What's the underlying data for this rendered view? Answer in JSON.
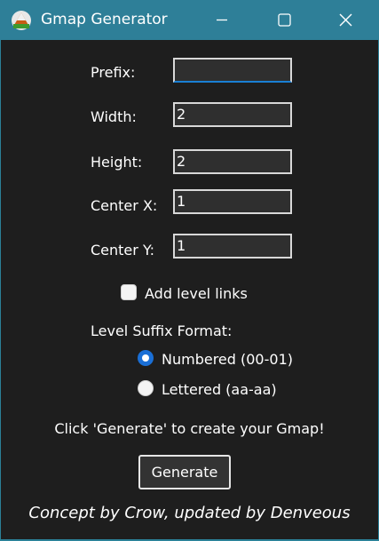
{
  "window": {
    "title": "Gmap Generator",
    "controls": {
      "minimize": "minimize-icon",
      "maximize": "maximize-icon",
      "close": "close-icon"
    }
  },
  "form": {
    "prefix": {
      "label": "Prefix:",
      "value": ""
    },
    "width": {
      "label": "Width:",
      "value": "2"
    },
    "height": {
      "label": "Height:",
      "value": "2"
    },
    "center_x": {
      "label": "Center X:",
      "value": "1"
    },
    "center_y": {
      "label": "Center Y:",
      "value": "1"
    },
    "level_links": {
      "label": "Add level links",
      "checked": false
    },
    "suffix_format": {
      "label": "Level Suffix Format:",
      "options": [
        {
          "label": "Numbered (00-01)",
          "selected": true
        },
        {
          "label": "Lettered (aa-aa)",
          "selected": false
        }
      ]
    }
  },
  "hint": "Click 'Generate' to create your Gmap!",
  "generate_label": "Generate",
  "credit": "Concept by Crow, updated by Denveous",
  "colors": {
    "background": "#1e1e1e",
    "titlebar": "#2e7f98",
    "radio_accent": "#1a6fd6"
  }
}
